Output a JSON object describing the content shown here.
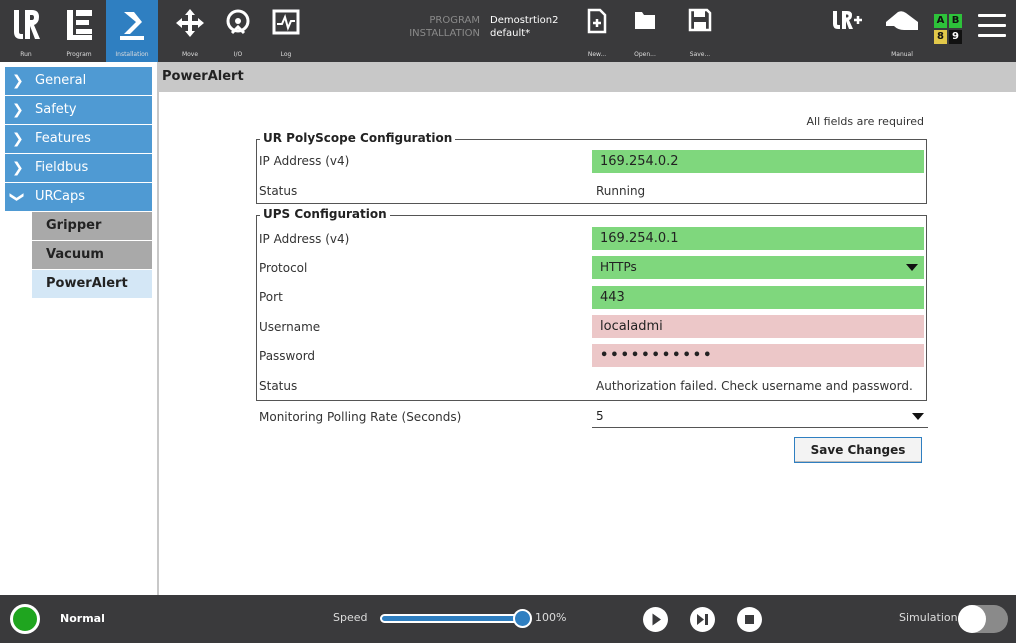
{
  "topbar": {
    "tabs": [
      {
        "label": "Run",
        "icon": "ur-logo-icon"
      },
      {
        "label": "Program",
        "icon": "program-icon"
      },
      {
        "label": "Installation",
        "icon": "installation-icon"
      }
    ],
    "actions": [
      {
        "label": "Move",
        "icon": "move-icon"
      },
      {
        "label": "I/O",
        "icon": "io-icon"
      },
      {
        "label": "Log",
        "icon": "log-icon"
      }
    ],
    "program_key": "PROGRAM",
    "program_value": "Demostrtion2",
    "installation_key": "INSTALLATION",
    "installation_value": "default*",
    "file_buttons": [
      {
        "label": "New...",
        "icon": "new-file-icon"
      },
      {
        "label": "Open...",
        "icon": "folder-icon"
      },
      {
        "label": "Save...",
        "icon": "save-icon"
      }
    ],
    "mode_label": "Manual",
    "ab": {
      "a": "A",
      "b": "B",
      "c": "8",
      "d": "9"
    }
  },
  "sidebar": {
    "items": [
      {
        "label": "General",
        "expanded": false
      },
      {
        "label": "Safety",
        "expanded": false
      },
      {
        "label": "Features",
        "expanded": false
      },
      {
        "label": "Fieldbus",
        "expanded": false
      },
      {
        "label": "URCaps",
        "expanded": true
      }
    ],
    "sub_items": [
      {
        "label": "Gripper",
        "selected": false
      },
      {
        "label": "Vacuum",
        "selected": false
      },
      {
        "label": "PowerAlert",
        "selected": true
      }
    ]
  },
  "main": {
    "title": "PowerAlert",
    "required_note": "All fields are required",
    "polyscope": {
      "title": "UR PolyScope Configuration",
      "ip_label": "IP Address (v4)",
      "ip_value": "169.254.0.2",
      "status_label": "Status",
      "status_value": "Running"
    },
    "ups": {
      "title": "UPS Configuration",
      "ip_label": "IP Address (v4)",
      "ip_value": "169.254.0.1",
      "protocol_label": "Protocol",
      "protocol_value": "HTTPs",
      "port_label": "Port",
      "port_value": "443",
      "username_label": "Username",
      "username_value": "localadmi",
      "password_label": "Password",
      "password_value": "•••••••••••",
      "status_label": "Status",
      "status_value": "Authorization failed. Check username and password."
    },
    "polling_label": "Monitoring Polling Rate (Seconds)",
    "polling_value": "5",
    "save_label": "Save Changes"
  },
  "footer": {
    "status": "Normal",
    "speed_label": "Speed",
    "speed_value": "100%",
    "speed_fraction": 1.0,
    "simulation_label": "Simulation",
    "simulation_on": false
  },
  "colors": {
    "topbar": "#3a3a3c",
    "accent": "#2f7fc1",
    "sidebar_item": "#4f9ad3",
    "valid_field": "#7fd77d",
    "invalid_field": "#ecc7c8",
    "status_ok": "#1fa51f"
  }
}
